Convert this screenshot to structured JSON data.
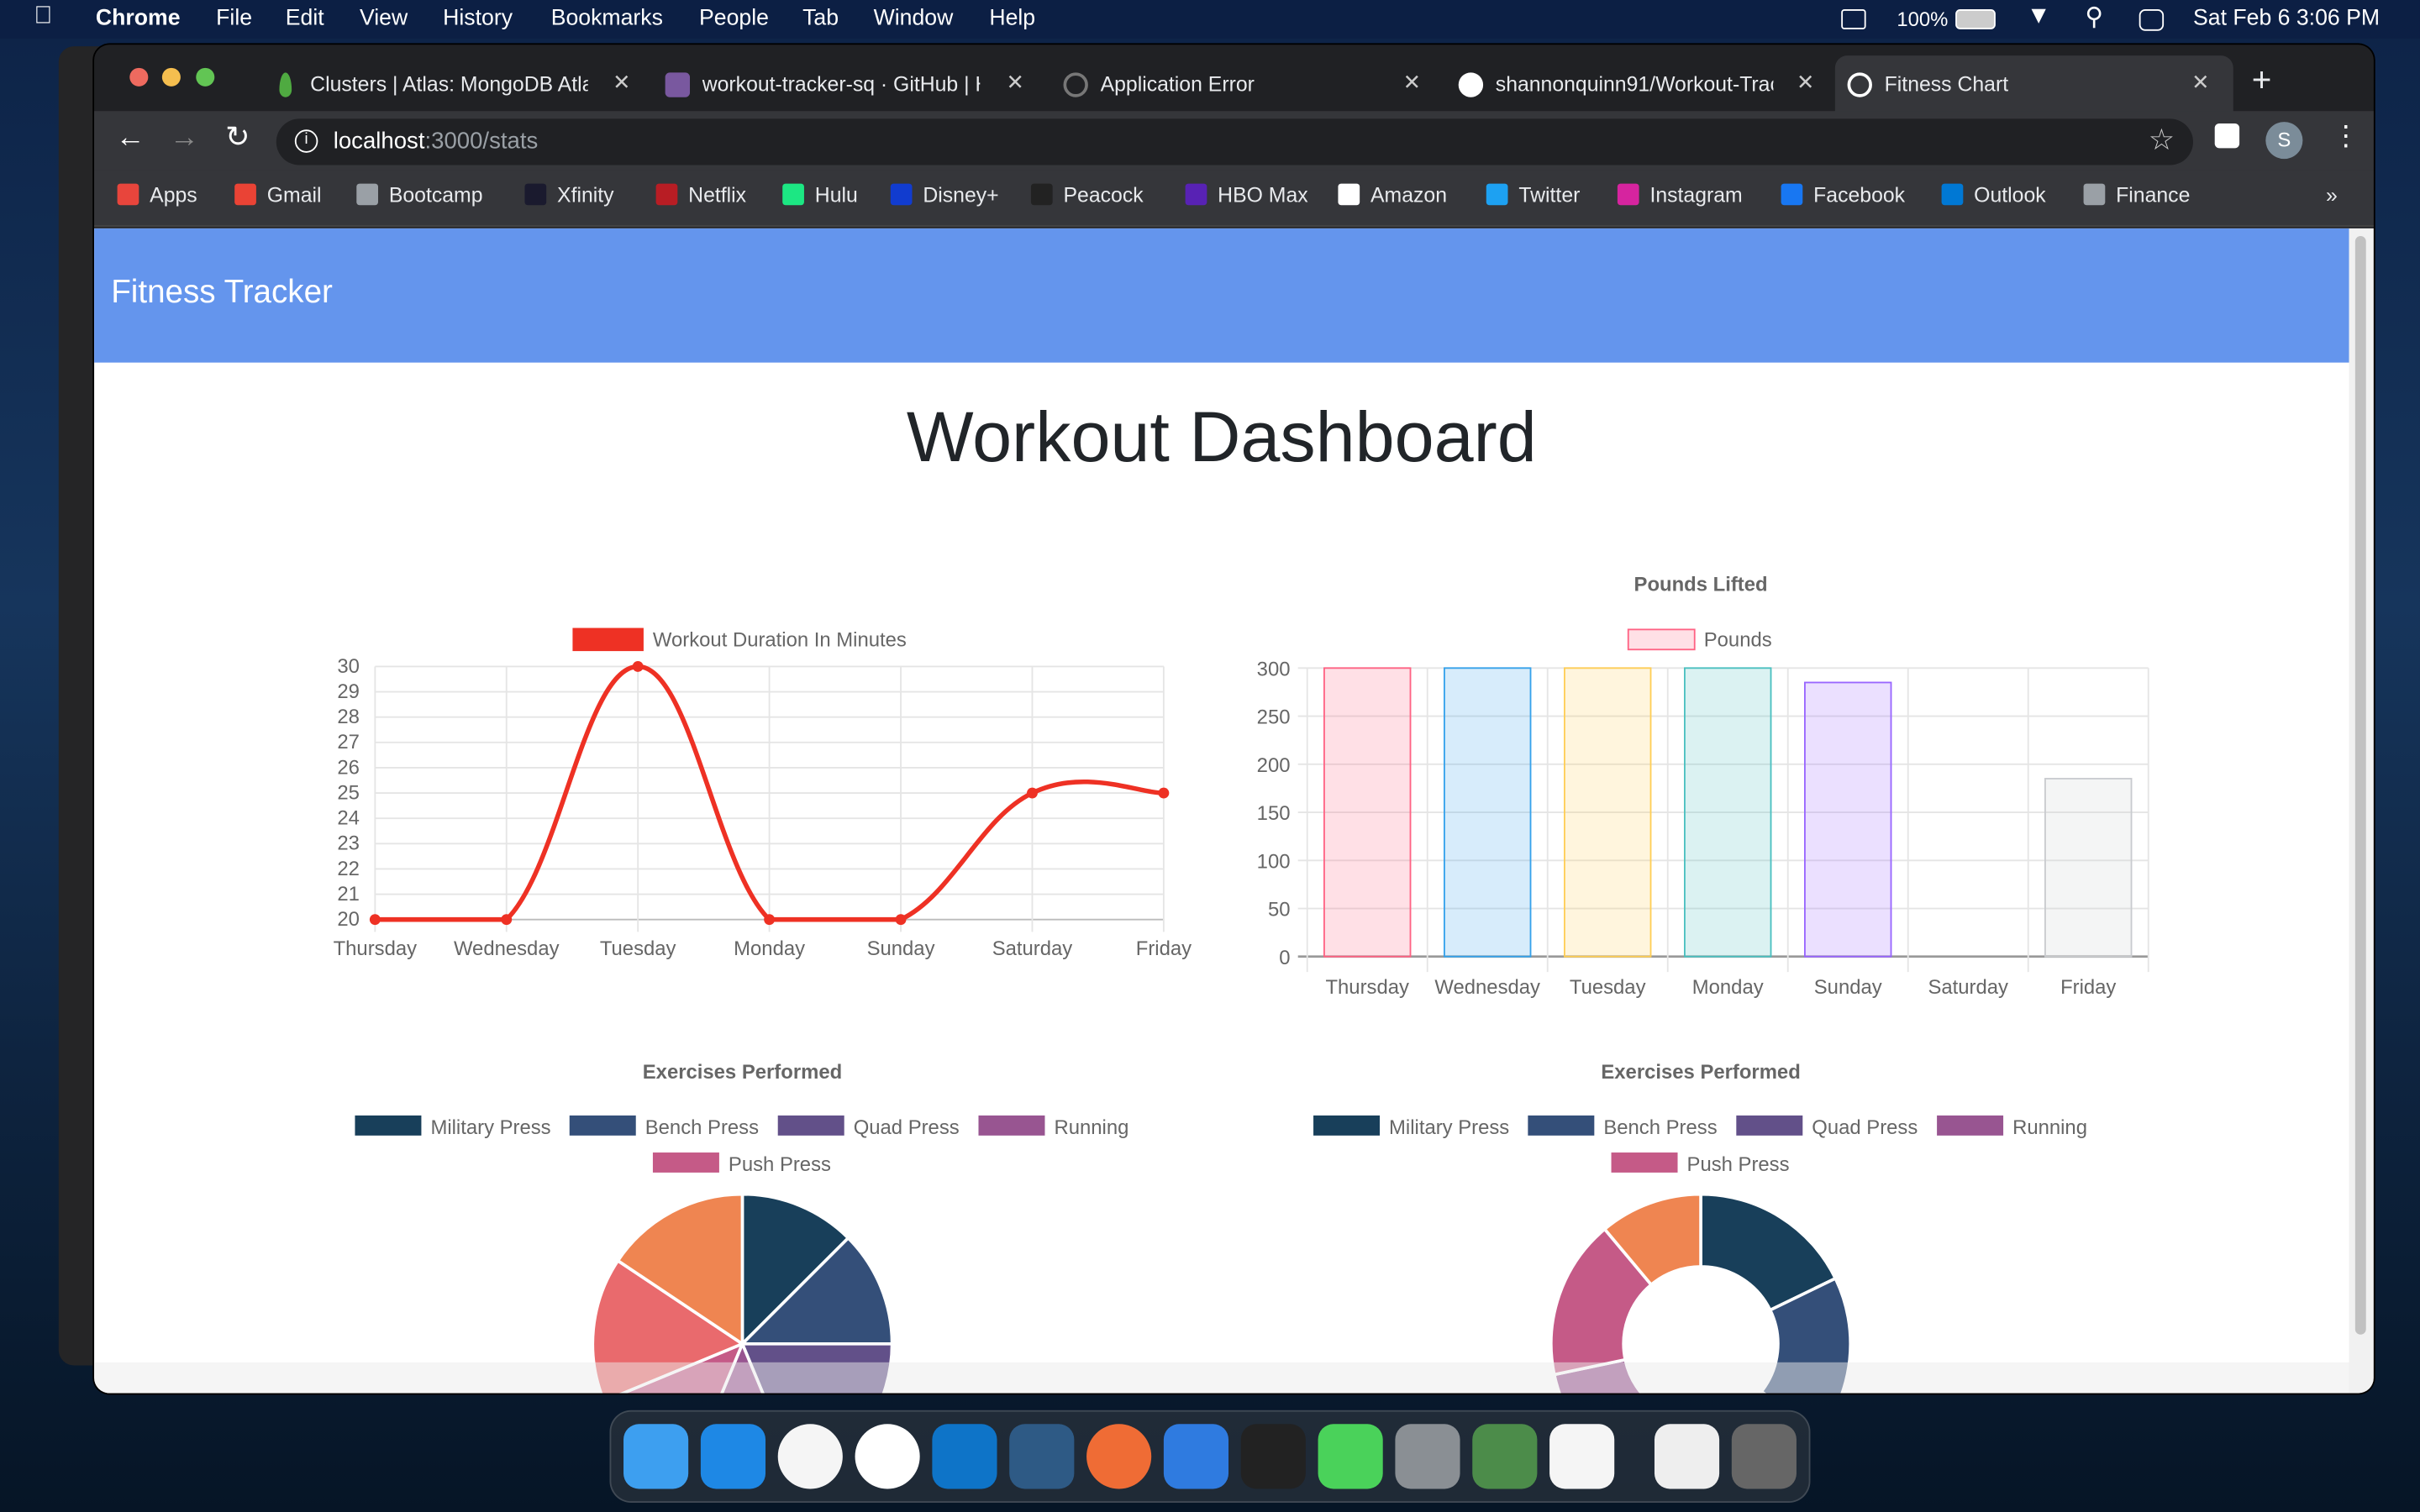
{
  "menubar": {
    "app": "Chrome",
    "items": [
      "File",
      "Edit",
      "View",
      "History",
      "Bookmarks",
      "People",
      "Tab",
      "Window",
      "Help"
    ],
    "battery": "100%",
    "datetime": "Sat Feb 6  3:06 PM"
  },
  "browser": {
    "tabs": [
      {
        "title": "Clusters | Atlas: MongoDB Atlas",
        "icon": "mongodb-leaf-icon"
      },
      {
        "title": "workout-tracker-sq · GitHub | H",
        "icon": "heroku-icon"
      },
      {
        "title": "Application Error",
        "icon": "globe-icon"
      },
      {
        "title": "shannonquinn91/Workout-Tracker",
        "icon": "github-icon"
      },
      {
        "title": "Fitness Chart",
        "icon": "globe-icon",
        "active": true
      }
    ],
    "url_host": "localhost",
    "url_path": ":3000/stats",
    "profile_initial": "S",
    "bookmarks": [
      {
        "label": "Apps",
        "color": "#e8453c"
      },
      {
        "label": "Gmail",
        "color": "#ea4335"
      },
      {
        "label": "Bootcamp",
        "color": "#9aa0a6"
      },
      {
        "label": "Xfinity",
        "color": "#1a1a2e"
      },
      {
        "label": "Netflix",
        "color": "#b81d24"
      },
      {
        "label": "Hulu",
        "color": "#1ce783"
      },
      {
        "label": "Disney+",
        "color": "#113ccf"
      },
      {
        "label": "Peacock",
        "color": "#222"
      },
      {
        "label": "HBO Max",
        "color": "#5822b4"
      },
      {
        "label": "Amazon",
        "color": "#ffffff"
      },
      {
        "label": "Twitter",
        "color": "#1da1f2"
      },
      {
        "label": "Instagram",
        "color": "#d6249f"
      },
      {
        "label": "Facebook",
        "color": "#1877f2"
      },
      {
        "label": "Outlook",
        "color": "#0078d4"
      },
      {
        "label": "Finance",
        "color": "#9aa0a6"
      }
    ],
    "more": "»"
  },
  "app": {
    "brand": "Fitness Tracker",
    "heading": "Workout Dashboard",
    "nav_color": "#6495ed"
  },
  "chart_data": [
    {
      "type": "line",
      "categories": [
        "Thursday",
        "Wednesday",
        "Tuesday",
        "Monday",
        "Sunday",
        "Saturday",
        "Friday"
      ],
      "series": [
        {
          "name": "Workout Duration In Minutes",
          "values": [
            20,
            20,
            30,
            20,
            20,
            25,
            25
          ],
          "color": "#ee3124"
        }
      ],
      "ylim": [
        20,
        30
      ],
      "yticks": [
        20,
        21,
        22,
        23,
        24,
        25,
        26,
        27,
        28,
        29,
        30
      ],
      "grid": true,
      "legend": "top"
    },
    {
      "type": "bar",
      "title": "Pounds Lifted",
      "categories": [
        "Thursday",
        "Wednesday",
        "Tuesday",
        "Monday",
        "Sunday",
        "Saturday",
        "Friday"
      ],
      "series": [
        {
          "name": "Pounds",
          "values": [
            300,
            300,
            300,
            300,
            285,
            0,
            185
          ]
        }
      ],
      "colors": [
        "#ff6384",
        "#36a2eb",
        "#ffce56",
        "#4bc0c0",
        "#9966ff",
        "#ff9f40",
        "#c9cbcf"
      ],
      "ylim": [
        0,
        300
      ],
      "yticks": [
        0,
        50,
        100,
        150,
        200,
        250,
        300
      ],
      "grid": true,
      "legend": "top"
    },
    {
      "type": "pie",
      "title": "Exercises Performed",
      "labels": [
        "Military Press",
        "Bench Press",
        "Quad Press",
        "Running",
        "Push Press"
      ],
      "values": [
        20,
        20,
        30,
        20,
        20,
        25,
        25
      ],
      "colors": [
        "#183f5a",
        "#344f79",
        "#625089",
        "#985591",
        "#c55a87",
        "#e96a6d",
        "#ef8551"
      ],
      "legend": "top"
    },
    {
      "type": "doughnut",
      "title": "Exercises Performed",
      "labels": [
        "Military Press",
        "Bench Press",
        "Quad Press",
        "Running",
        "Push Press"
      ],
      "values": [
        17.8,
        17.8,
        16.1,
        20,
        17.2,
        11.1
      ],
      "colors": [
        "#183f5a",
        "#344f79",
        "#625089",
        "#985591",
        "#c55a87",
        "#ef8551"
      ],
      "legend": "top"
    }
  ]
}
